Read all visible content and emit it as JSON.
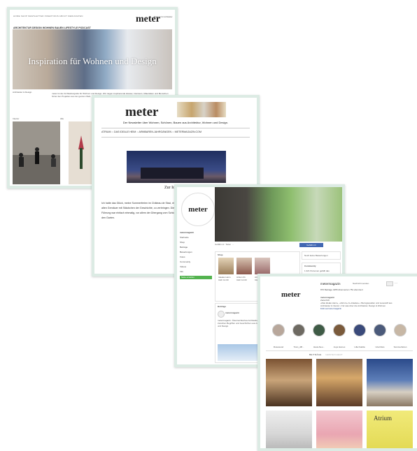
{
  "card1": {
    "nav_top": "HOME  SHOP  NEWSLETTER  INSERTIONS  ABOUT  MEDIADATEN",
    "nav_main": "ARCHITEKTUR   DESIGN   WOHNEN   BAUEN   LIFESTYLE   PODCAST",
    "brand": "meter",
    "brand_sub": "Magazin für Architektur",
    "hero_title": "Inspiration für Wohnen und Design",
    "hero_caption": "Architektur & Design",
    "paragraph": "meter ist der Architekturguide für Wohnen und Design. Wir zeigen inspirierende Häuser, Interieurs, Materialien und Menschen hinter den Projekten aus der ganzen Welt.",
    "photo_labels": [
      "Interior",
      "Alle"
    ]
  },
  "card2": {
    "brand": "meter",
    "tagline": "Der Newsletter über Wohnen, Schönen, Bauen aus Architektur, Wohnen und Design.",
    "menu": [
      "ATRIUM",
      "DAS IDEALE HEIM",
      "ARMBAREN-JAHRGÄNGEN",
      "METERMAGAZIN.COM"
    ],
    "subtitle": "Zur Ideen",
    "body": "Ich hatte das Glück, meine Sommerferien im Château de Sissi, einem alten Gemäuer mit Stäubchen der Geschichte, zu verbringen. Die Führung war einfach einmalig, vor allem der Übergang vom Schloss in den Garten."
  },
  "card3": {
    "avatar_text": "meter",
    "page_name": "metermagazin",
    "left_menu": [
      "Startseite",
      "Shop",
      "Beiträge",
      "Bewertungen",
      "Fotos",
      "Community",
      "Videos",
      "Info"
    ],
    "left_button": "Seite erstellen",
    "actions": [
      "Gefällt mir",
      "Teilen",
      "..."
    ],
    "like_button": "Gefällt mir",
    "shop_title": "Shop",
    "shop_items": [
      {
        "name": "Ideales Heim",
        "price": "CHF 12.00"
      },
      {
        "name": "Atrium 01",
        "price": "CHF 14.00"
      },
      {
        "name": "Atrium 02",
        "price": "CHF 14.00"
      }
    ],
    "shop_more": "Alle ansehen",
    "review_label": "Noch keine Bewertungen",
    "community_title": "Community",
    "community_line": "1.321 Personen gefällt das",
    "posts_title": "Beiträge",
    "post_author": "metermagazin",
    "post_text": "metermagazin. Österreichisches Architekturmagazin zwischen Begriffen und Geschichten aus Architektur und Design."
  },
  "card4": {
    "brand": "meter",
    "handle": "metermagazin",
    "follow_label": "Nachricht senden",
    "stats": "876 Beiträge   4455 Abonnenten   751 abonniert",
    "bio_lines": [
      "metermagazin",
      "Zeitschrift",
      "«Das ideale Heim», «Atrium» & «Ideales» • Bezugsquellen und Lesestoff aus",
      "Architektur & Interior • Für was über die Architektur, Design & Wohnen"
    ],
    "link": "linktr.ee/metermagazin",
    "highlights": [
      "Rosewood",
      "Tram_diff...",
      "Haus-Neu...",
      "Joya Homes",
      "Lilla Nudda",
      "Uriel Reis",
      "Sommerferien"
    ],
    "highlight_colors": [
      "#b8a79b",
      "#6e6a62",
      "#3f5b46",
      "#7a5a3b",
      "#3a4a7a",
      "#4b5a7a",
      "#c7b7a5"
    ],
    "tabs": [
      "BEITRÄGE",
      "GESPEICHERT"
    ],
    "magazine_label": "Atrium"
  }
}
